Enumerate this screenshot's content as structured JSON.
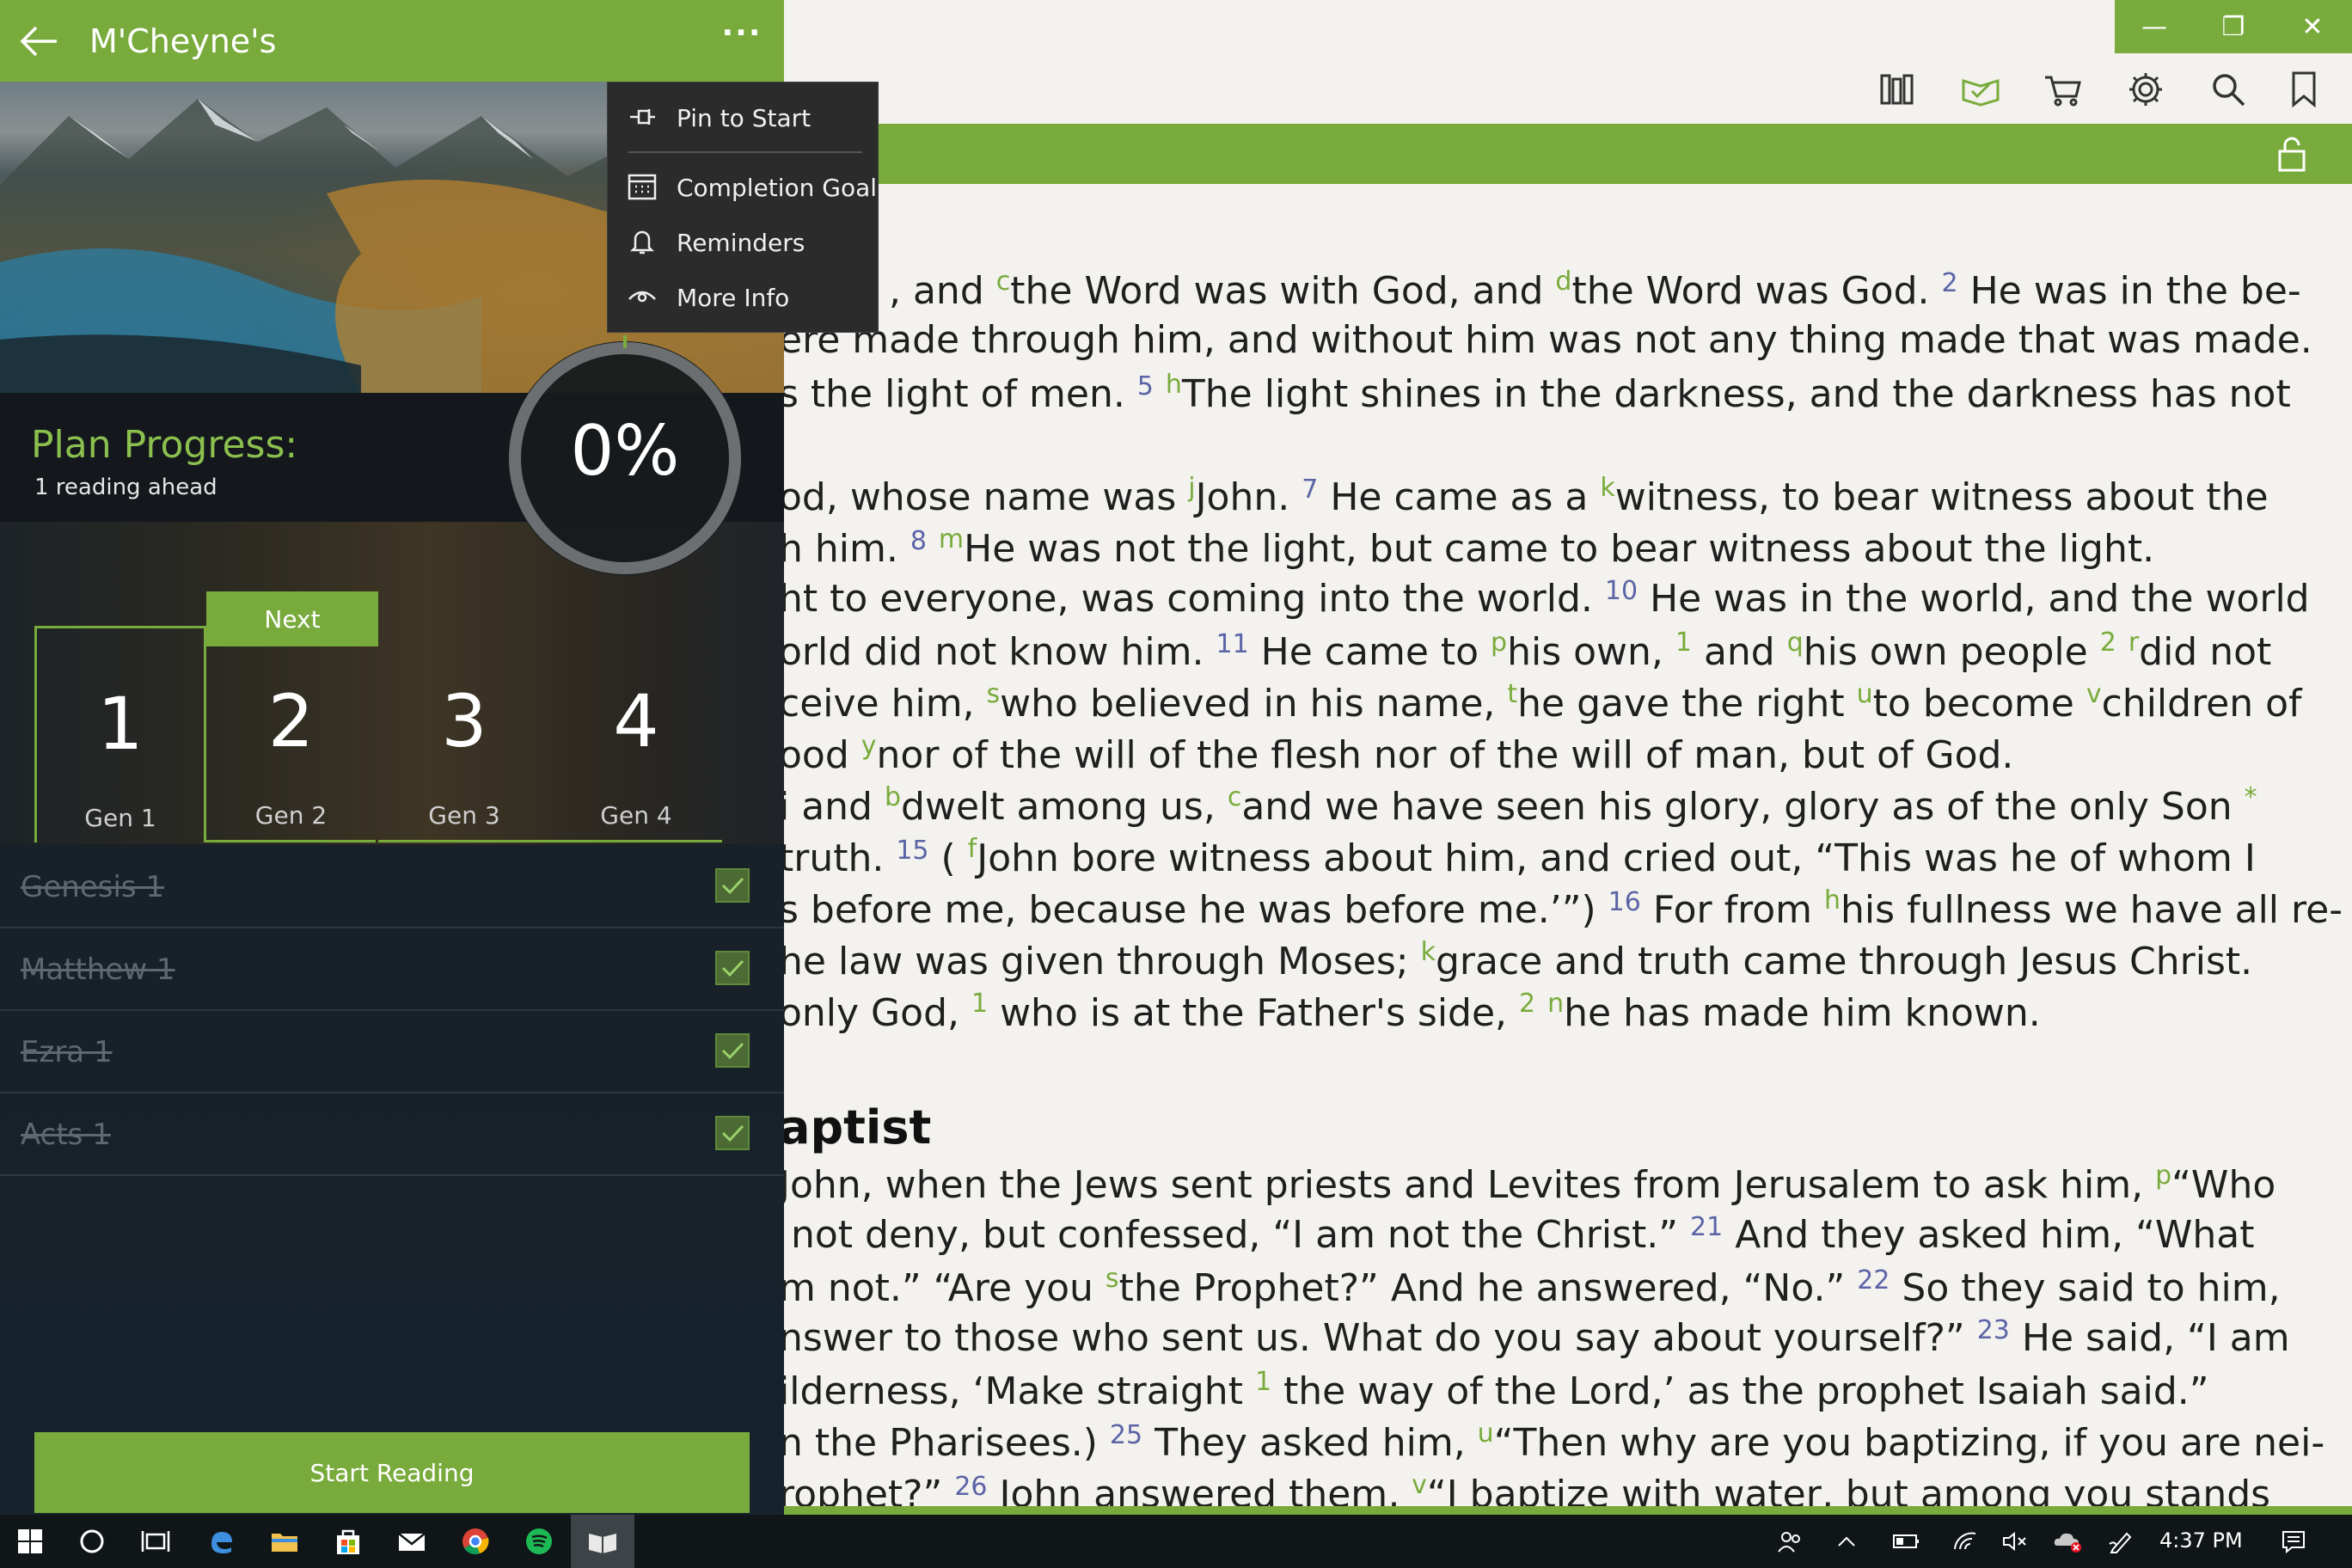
{
  "plan_panel": {
    "title": "M'Cheyne's",
    "progress_label": "Plan Progress:",
    "progress_sub": "1 reading ahead",
    "progress_percent": "0%",
    "progress_value": 0,
    "next_label": "Next",
    "days": [
      {
        "num": "1",
        "label": "Gen 1"
      },
      {
        "num": "2",
        "label": "Gen 2"
      },
      {
        "num": "3",
        "label": "Gen 3"
      },
      {
        "num": "4",
        "label": "Gen 4"
      }
    ],
    "readings": [
      "Genesis 1",
      "Matthew 1",
      "Ezra 1",
      "Acts 1"
    ],
    "start_button": "Start Reading"
  },
  "context_menu": {
    "items": [
      "Pin to Start",
      "Completion Goal",
      "Reminders",
      "More Info"
    ]
  },
  "toolbar": {
    "icons": [
      "library-icon",
      "reading-plan-icon",
      "cart-icon",
      "settings-icon",
      "search-icon",
      "bookmark-icon",
      "lock-icon"
    ]
  },
  "window_controls": [
    "minimize",
    "restore",
    "close"
  ],
  "taskbar": {
    "time": "4:37 PM"
  },
  "colors": {
    "accent": "#78ab3c",
    "verse_number": "#5b64a6",
    "menu_bg": "#2b2b2b"
  }
}
